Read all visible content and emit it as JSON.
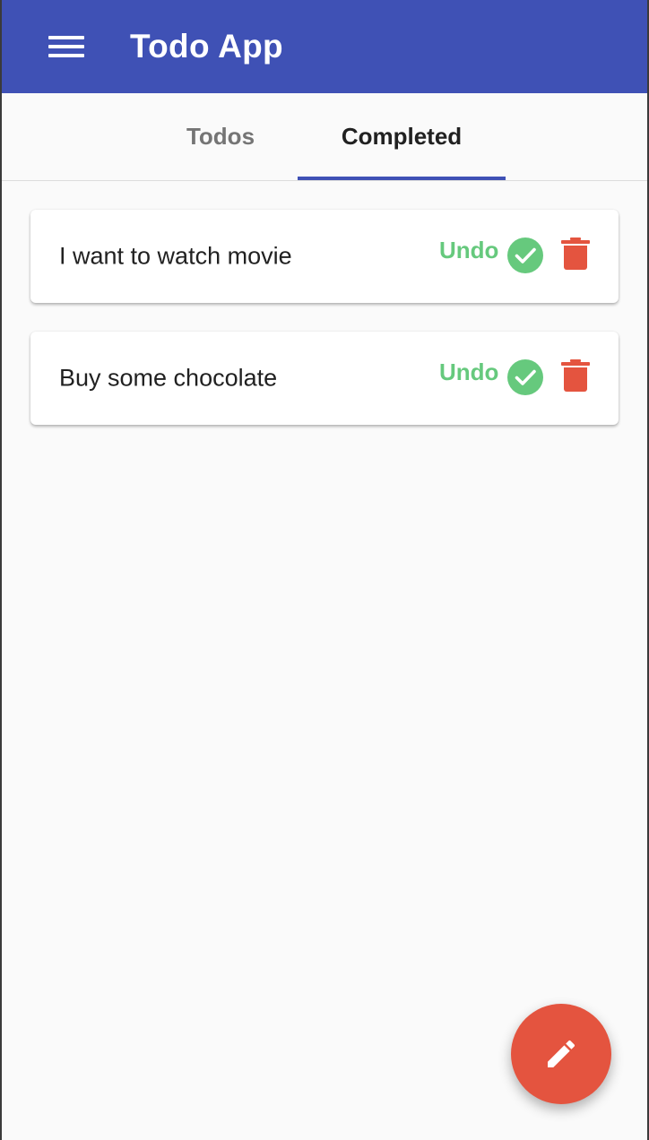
{
  "app": {
    "title": "Todo App",
    "menu_icon": "hamburger-menu-icon"
  },
  "tabs": [
    {
      "label": "Todos",
      "active": false
    },
    {
      "label": "Completed",
      "active": true
    }
  ],
  "todos": [
    {
      "text": "I want to watch movie",
      "undo_label": "Undo"
    },
    {
      "text": "Buy some chocolate",
      "undo_label": "Undo"
    }
  ],
  "fab": {
    "icon": "pencil-icon"
  },
  "colors": {
    "primary": "#3f51b5",
    "undo": "#66c97d",
    "check": "#66c97d",
    "delete": "#e4543f",
    "fab": "#e4543f"
  }
}
